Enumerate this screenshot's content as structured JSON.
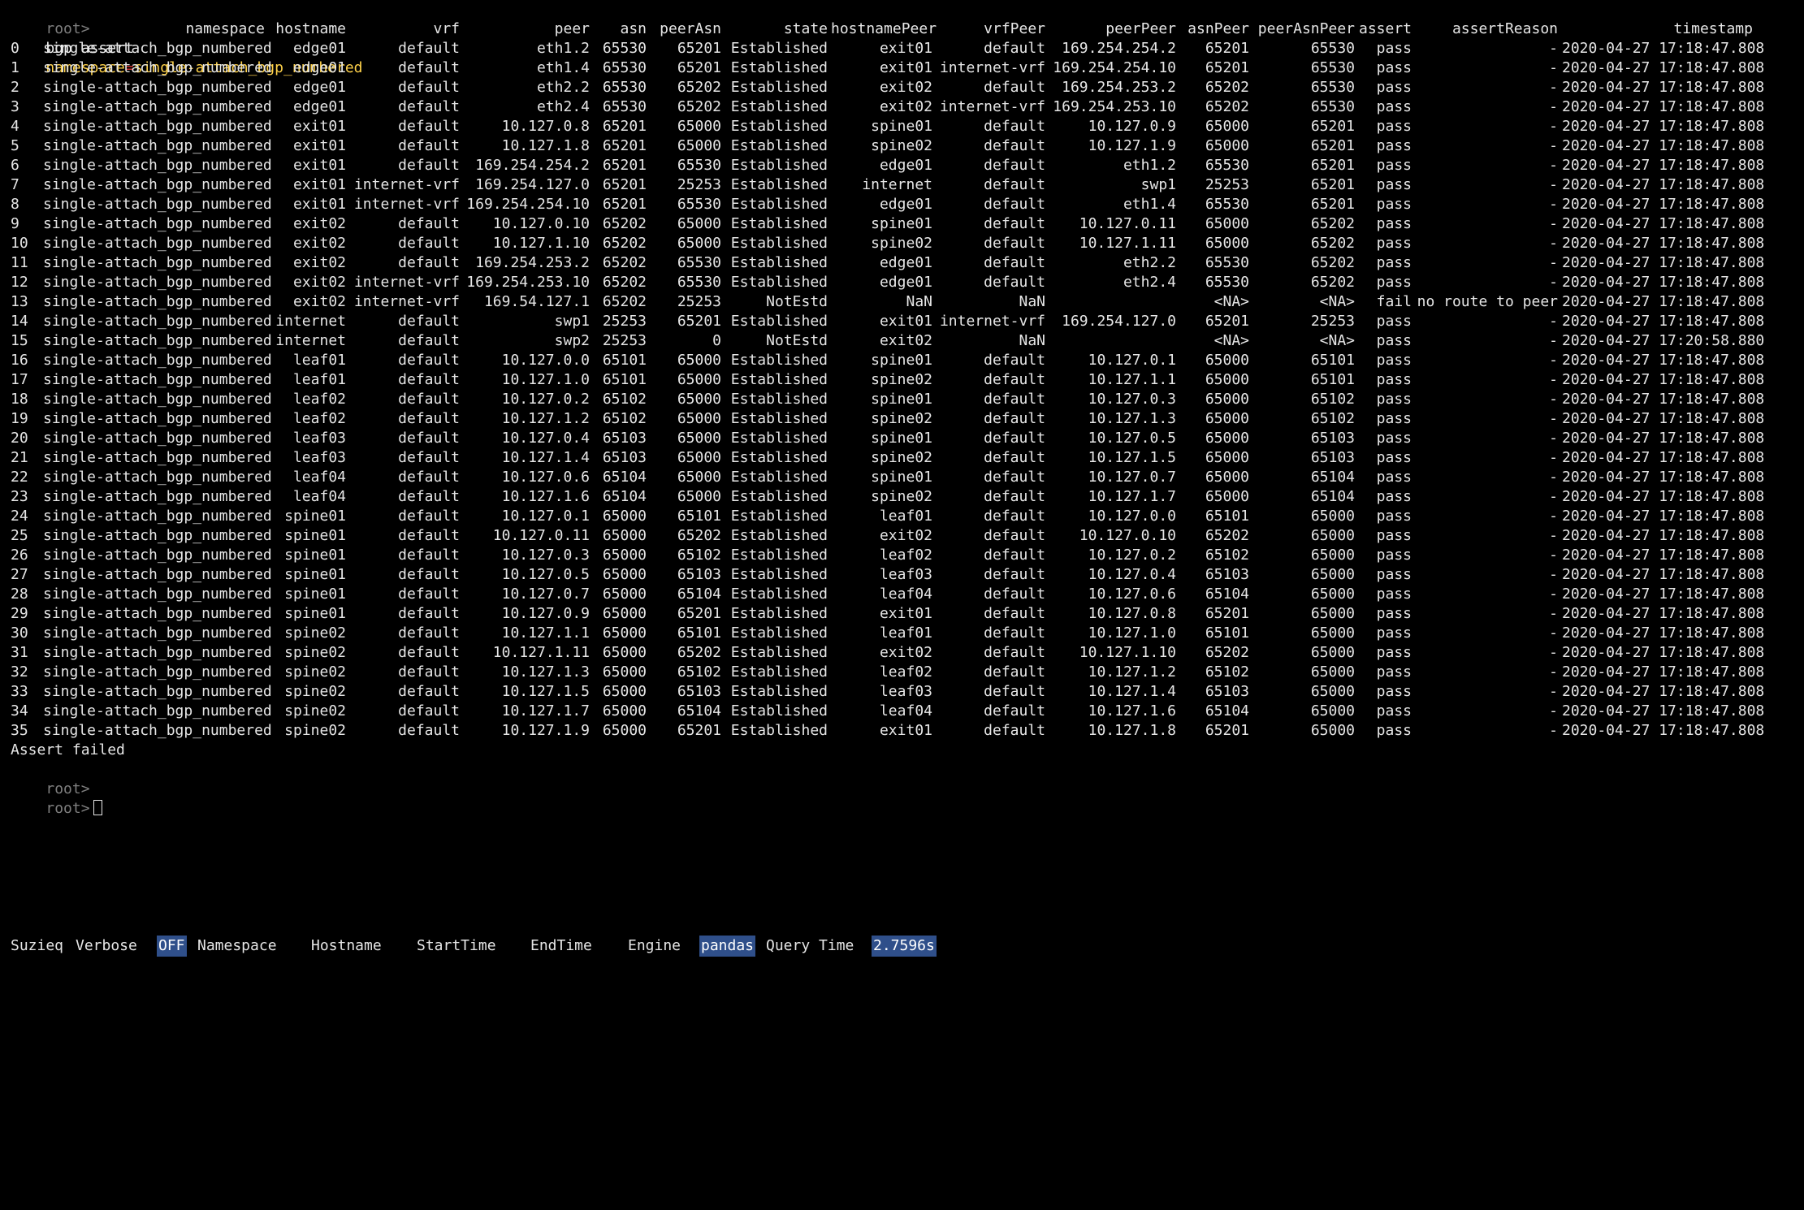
{
  "prompt_label": "root>",
  "command": {
    "text": "bgp assert",
    "arg_key": "namespace",
    "arg_eq": "=",
    "arg_value": "single-attach_bgp_numbered"
  },
  "table": {
    "columns": [
      "",
      "namespace",
      "hostname",
      "vrf",
      "peer",
      "asn",
      "peerAsn",
      "state",
      "hostnamePeer",
      "vrfPeer",
      "peerPeer",
      "asnPeer",
      "peerAsnPeer",
      "assert",
      "assertReason",
      "timestamp"
    ],
    "rows": [
      [
        "0",
        "single-attach_bgp_numbered",
        "edge01",
        "default",
        "eth1.2",
        "65530",
        "65201",
        "Established",
        "exit01",
        "default",
        "169.254.254.2",
        "65201",
        "65530",
        "pass",
        "-",
        "2020-04-27 17:18:47.808"
      ],
      [
        "1",
        "single-attach_bgp_numbered",
        "edge01",
        "default",
        "eth1.4",
        "65530",
        "65201",
        "Established",
        "exit01",
        "internet-vrf",
        "169.254.254.10",
        "65201",
        "65530",
        "pass",
        "-",
        "2020-04-27 17:18:47.808"
      ],
      [
        "2",
        "single-attach_bgp_numbered",
        "edge01",
        "default",
        "eth2.2",
        "65530",
        "65202",
        "Established",
        "exit02",
        "default",
        "169.254.253.2",
        "65202",
        "65530",
        "pass",
        "-",
        "2020-04-27 17:18:47.808"
      ],
      [
        "3",
        "single-attach_bgp_numbered",
        "edge01",
        "default",
        "eth2.4",
        "65530",
        "65202",
        "Established",
        "exit02",
        "internet-vrf",
        "169.254.253.10",
        "65202",
        "65530",
        "pass",
        "-",
        "2020-04-27 17:18:47.808"
      ],
      [
        "4",
        "single-attach_bgp_numbered",
        "exit01",
        "default",
        "10.127.0.8",
        "65201",
        "65000",
        "Established",
        "spine01",
        "default",
        "10.127.0.9",
        "65000",
        "65201",
        "pass",
        "-",
        "2020-04-27 17:18:47.808"
      ],
      [
        "5",
        "single-attach_bgp_numbered",
        "exit01",
        "default",
        "10.127.1.8",
        "65201",
        "65000",
        "Established",
        "spine02",
        "default",
        "10.127.1.9",
        "65000",
        "65201",
        "pass",
        "-",
        "2020-04-27 17:18:47.808"
      ],
      [
        "6",
        "single-attach_bgp_numbered",
        "exit01",
        "default",
        "169.254.254.2",
        "65201",
        "65530",
        "Established",
        "edge01",
        "default",
        "eth1.2",
        "65530",
        "65201",
        "pass",
        "-",
        "2020-04-27 17:18:47.808"
      ],
      [
        "7",
        "single-attach_bgp_numbered",
        "exit01",
        "internet-vrf",
        "169.254.127.0",
        "65201",
        "25253",
        "Established",
        "internet",
        "default",
        "swp1",
        "25253",
        "65201",
        "pass",
        "-",
        "2020-04-27 17:18:47.808"
      ],
      [
        "8",
        "single-attach_bgp_numbered",
        "exit01",
        "internet-vrf",
        "169.254.254.10",
        "65201",
        "65530",
        "Established",
        "edge01",
        "default",
        "eth1.4",
        "65530",
        "65201",
        "pass",
        "-",
        "2020-04-27 17:18:47.808"
      ],
      [
        "9",
        "single-attach_bgp_numbered",
        "exit02",
        "default",
        "10.127.0.10",
        "65202",
        "65000",
        "Established",
        "spine01",
        "default",
        "10.127.0.11",
        "65000",
        "65202",
        "pass",
        "-",
        "2020-04-27 17:18:47.808"
      ],
      [
        "10",
        "single-attach_bgp_numbered",
        "exit02",
        "default",
        "10.127.1.10",
        "65202",
        "65000",
        "Established",
        "spine02",
        "default",
        "10.127.1.11",
        "65000",
        "65202",
        "pass",
        "-",
        "2020-04-27 17:18:47.808"
      ],
      [
        "11",
        "single-attach_bgp_numbered",
        "exit02",
        "default",
        "169.254.253.2",
        "65202",
        "65530",
        "Established",
        "edge01",
        "default",
        "eth2.2",
        "65530",
        "65202",
        "pass",
        "-",
        "2020-04-27 17:18:47.808"
      ],
      [
        "12",
        "single-attach_bgp_numbered",
        "exit02",
        "internet-vrf",
        "169.254.253.10",
        "65202",
        "65530",
        "Established",
        "edge01",
        "default",
        "eth2.4",
        "65530",
        "65202",
        "pass",
        "-",
        "2020-04-27 17:18:47.808"
      ],
      [
        "13",
        "single-attach_bgp_numbered",
        "exit02",
        "internet-vrf",
        "169.54.127.1",
        "65202",
        "25253",
        "NotEstd",
        "NaN",
        "NaN",
        "",
        "<NA>",
        "<NA>",
        "fail",
        "no route to peer",
        "2020-04-27 17:18:47.808"
      ],
      [
        "14",
        "single-attach_bgp_numbered",
        "internet",
        "default",
        "swp1",
        "25253",
        "65201",
        "Established",
        "exit01",
        "internet-vrf",
        "169.254.127.0",
        "65201",
        "25253",
        "pass",
        "-",
        "2020-04-27 17:18:47.808"
      ],
      [
        "15",
        "single-attach_bgp_numbered",
        "internet",
        "default",
        "swp2",
        "25253",
        "0",
        "NotEstd",
        "exit02",
        "NaN",
        "",
        "<NA>",
        "<NA>",
        "pass",
        "-",
        "2020-04-27 17:20:58.880"
      ],
      [
        "16",
        "single-attach_bgp_numbered",
        "leaf01",
        "default",
        "10.127.0.0",
        "65101",
        "65000",
        "Established",
        "spine01",
        "default",
        "10.127.0.1",
        "65000",
        "65101",
        "pass",
        "-",
        "2020-04-27 17:18:47.808"
      ],
      [
        "17",
        "single-attach_bgp_numbered",
        "leaf01",
        "default",
        "10.127.1.0",
        "65101",
        "65000",
        "Established",
        "spine02",
        "default",
        "10.127.1.1",
        "65000",
        "65101",
        "pass",
        "-",
        "2020-04-27 17:18:47.808"
      ],
      [
        "18",
        "single-attach_bgp_numbered",
        "leaf02",
        "default",
        "10.127.0.2",
        "65102",
        "65000",
        "Established",
        "spine01",
        "default",
        "10.127.0.3",
        "65000",
        "65102",
        "pass",
        "-",
        "2020-04-27 17:18:47.808"
      ],
      [
        "19",
        "single-attach_bgp_numbered",
        "leaf02",
        "default",
        "10.127.1.2",
        "65102",
        "65000",
        "Established",
        "spine02",
        "default",
        "10.127.1.3",
        "65000",
        "65102",
        "pass",
        "-",
        "2020-04-27 17:18:47.808"
      ],
      [
        "20",
        "single-attach_bgp_numbered",
        "leaf03",
        "default",
        "10.127.0.4",
        "65103",
        "65000",
        "Established",
        "spine01",
        "default",
        "10.127.0.5",
        "65000",
        "65103",
        "pass",
        "-",
        "2020-04-27 17:18:47.808"
      ],
      [
        "21",
        "single-attach_bgp_numbered",
        "leaf03",
        "default",
        "10.127.1.4",
        "65103",
        "65000",
        "Established",
        "spine02",
        "default",
        "10.127.1.5",
        "65000",
        "65103",
        "pass",
        "-",
        "2020-04-27 17:18:47.808"
      ],
      [
        "22",
        "single-attach_bgp_numbered",
        "leaf04",
        "default",
        "10.127.0.6",
        "65104",
        "65000",
        "Established",
        "spine01",
        "default",
        "10.127.0.7",
        "65000",
        "65104",
        "pass",
        "-",
        "2020-04-27 17:18:47.808"
      ],
      [
        "23",
        "single-attach_bgp_numbered",
        "leaf04",
        "default",
        "10.127.1.6",
        "65104",
        "65000",
        "Established",
        "spine02",
        "default",
        "10.127.1.7",
        "65000",
        "65104",
        "pass",
        "-",
        "2020-04-27 17:18:47.808"
      ],
      [
        "24",
        "single-attach_bgp_numbered",
        "spine01",
        "default",
        "10.127.0.1",
        "65000",
        "65101",
        "Established",
        "leaf01",
        "default",
        "10.127.0.0",
        "65101",
        "65000",
        "pass",
        "-",
        "2020-04-27 17:18:47.808"
      ],
      [
        "25",
        "single-attach_bgp_numbered",
        "spine01",
        "default",
        "10.127.0.11",
        "65000",
        "65202",
        "Established",
        "exit02",
        "default",
        "10.127.0.10",
        "65202",
        "65000",
        "pass",
        "-",
        "2020-04-27 17:18:47.808"
      ],
      [
        "26",
        "single-attach_bgp_numbered",
        "spine01",
        "default",
        "10.127.0.3",
        "65000",
        "65102",
        "Established",
        "leaf02",
        "default",
        "10.127.0.2",
        "65102",
        "65000",
        "pass",
        "-",
        "2020-04-27 17:18:47.808"
      ],
      [
        "27",
        "single-attach_bgp_numbered",
        "spine01",
        "default",
        "10.127.0.5",
        "65000",
        "65103",
        "Established",
        "leaf03",
        "default",
        "10.127.0.4",
        "65103",
        "65000",
        "pass",
        "-",
        "2020-04-27 17:18:47.808"
      ],
      [
        "28",
        "single-attach_bgp_numbered",
        "spine01",
        "default",
        "10.127.0.7",
        "65000",
        "65104",
        "Established",
        "leaf04",
        "default",
        "10.127.0.6",
        "65104",
        "65000",
        "pass",
        "-",
        "2020-04-27 17:18:47.808"
      ],
      [
        "29",
        "single-attach_bgp_numbered",
        "spine01",
        "default",
        "10.127.0.9",
        "65000",
        "65201",
        "Established",
        "exit01",
        "default",
        "10.127.0.8",
        "65201",
        "65000",
        "pass",
        "-",
        "2020-04-27 17:18:47.808"
      ],
      [
        "30",
        "single-attach_bgp_numbered",
        "spine02",
        "default",
        "10.127.1.1",
        "65000",
        "65101",
        "Established",
        "leaf01",
        "default",
        "10.127.1.0",
        "65101",
        "65000",
        "pass",
        "-",
        "2020-04-27 17:18:47.808"
      ],
      [
        "31",
        "single-attach_bgp_numbered",
        "spine02",
        "default",
        "10.127.1.11",
        "65000",
        "65202",
        "Established",
        "exit02",
        "default",
        "10.127.1.10",
        "65202",
        "65000",
        "pass",
        "-",
        "2020-04-27 17:18:47.808"
      ],
      [
        "32",
        "single-attach_bgp_numbered",
        "spine02",
        "default",
        "10.127.1.3",
        "65000",
        "65102",
        "Established",
        "leaf02",
        "default",
        "10.127.1.2",
        "65102",
        "65000",
        "pass",
        "-",
        "2020-04-27 17:18:47.808"
      ],
      [
        "33",
        "single-attach_bgp_numbered",
        "spine02",
        "default",
        "10.127.1.5",
        "65000",
        "65103",
        "Established",
        "leaf03",
        "default",
        "10.127.1.4",
        "65103",
        "65000",
        "pass",
        "-",
        "2020-04-27 17:18:47.808"
      ],
      [
        "34",
        "single-attach_bgp_numbered",
        "spine02",
        "default",
        "10.127.1.7",
        "65000",
        "65104",
        "Established",
        "leaf04",
        "default",
        "10.127.1.6",
        "65104",
        "65000",
        "pass",
        "-",
        "2020-04-27 17:18:47.808"
      ],
      [
        "35",
        "single-attach_bgp_numbered",
        "spine02",
        "default",
        "10.127.1.9",
        "65000",
        "65201",
        "Established",
        "exit01",
        "default",
        "10.127.1.8",
        "65201",
        "65000",
        "pass",
        "-",
        "2020-04-27 17:18:47.808"
      ]
    ]
  },
  "result_message": "Assert failed",
  "statusbar": {
    "app": "Suzieq",
    "verbose_label": "Verbose",
    "verbose_value": "OFF",
    "namespace_label": "Namespace",
    "hostname_label": "Hostname",
    "starttime_label": "StartTime",
    "endtime_label": "EndTime",
    "engine_label": "Engine",
    "engine_value": "pandas",
    "querytime_label": "Query Time",
    "querytime_value": "2.7596s"
  },
  "colors": {
    "background": "#000000",
    "text": "#e6e6e6",
    "prompt": "#7f7f7f",
    "argument": "#ffd24a",
    "highlight": "#2f4f8a"
  },
  "icons": {
    "cursor": "block-cursor-icon"
  }
}
